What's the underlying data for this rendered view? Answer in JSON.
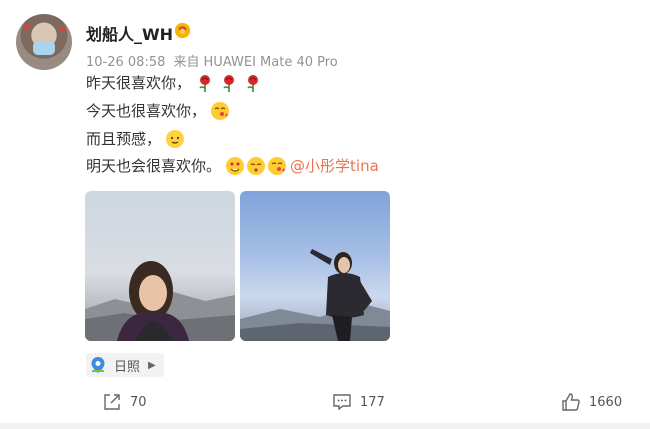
{
  "post": {
    "author": "划船人_WH",
    "time": "10-26 08:58",
    "source_prefix": "来自",
    "source_device": "HUAWEI Mate 40 Pro",
    "lines": [
      "昨天很喜欢你，",
      "今天也很喜欢你，",
      "而且预感，",
      "明天也会很喜欢你。"
    ],
    "mention": "@小彤学tina",
    "location": "日照"
  },
  "stats": {
    "shares": "70",
    "comments": "177",
    "likes": "1660"
  },
  "colors": {
    "mention": "#eb7350",
    "meta": "#939393",
    "location_bg": "#f2f2f5"
  },
  "icons": [
    "vip-badge-icon",
    "rose-icon",
    "kiss-emoji-icon",
    "blush-emoji-icon",
    "heart-eyes-emoji-icon",
    "location-pin-icon",
    "chevron-right-icon",
    "share-icon",
    "comment-icon",
    "like-icon"
  ]
}
